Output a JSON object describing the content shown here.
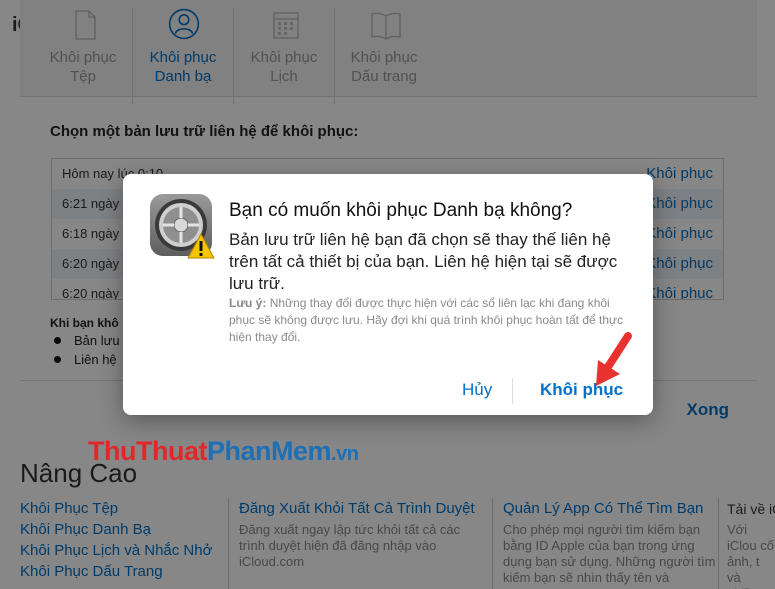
{
  "background": {
    "logo": "iC",
    "advanced_title": "Nâng Cao",
    "advanced_links": [
      "Khôi Phục Tệp",
      "Khôi Phục Danh Bạ",
      "Khôi Phục Lịch và Nhắc Nhở",
      "Khôi Phục Dấu Trang"
    ],
    "col2": {
      "title": "Đăng Xuất Khỏi Tất Cả Trình Duyệt",
      "desc": "Đăng xuất ngay lập tức khỏi tất cả các trình duyệt hiện đã đăng nhập vào iCloud.com"
    },
    "col3": {
      "title": "Quản Lý App Có Thể Tìm Bạn",
      "desc": "Cho phép mọi người tìm kiếm bạn bằng ID Apple của bạn trong ứng dụng bạn sử dụng. Những người tìm kiếm bạn sẽ nhìn thấy tên và"
    },
    "col4": {
      "title": "Tải về iC",
      "desc": "Với iClou cố ảnh, t và nhiều"
    }
  },
  "panel": {
    "tabs": [
      {
        "line1": "Khôi phục",
        "line2": "Tệp",
        "icon": "file-icon",
        "active": false
      },
      {
        "line1": "Khôi phục",
        "line2": "Danh bạ",
        "icon": "contact-icon",
        "active": true
      },
      {
        "line1": "Khôi phục",
        "line2": "Lịch",
        "icon": "calendar-icon",
        "active": false
      },
      {
        "line1": "Khôi phục",
        "line2": "Dấu trang",
        "icon": "book-icon",
        "active": false
      }
    ],
    "prompt": "Chọn một bản lưu trữ liên hệ để khôi phục:",
    "rows": [
      {
        "date": "Hôm nay lúc 0:10",
        "action": "Khôi phục"
      },
      {
        "date": "6:21 ngày",
        "action": "Khôi phục"
      },
      {
        "date": "6:18 ngày",
        "action": "Khôi phục"
      },
      {
        "date": "6:20 ngày",
        "action": "Khôi phục"
      },
      {
        "date": "6:20 ngày",
        "action": "Khôi phục"
      }
    ],
    "when_label": "Khi bạn khô",
    "bullets": [
      "Bản lưu",
      "Liên hệ"
    ],
    "done_label": "Xong"
  },
  "alert": {
    "icon": "settings-gear-icon",
    "warning_icon": "warning-icon",
    "title": "Bạn có muốn khôi phục Danh bạ không?",
    "message": "Bản lưu trữ liên hệ bạn đã chọn sẽ thay thế liên hệ trên tất cả thiết bị của bạn. Liên hệ hiện tại sẽ được lưu trữ.",
    "note_label": "Lưu ý:",
    "note_text": " Những thay đổi được thực hiện với các sổ liên lạc khi đang khôi phục sẽ không được lưu. Hãy đợi khi quá trình khôi phục hoàn tất để thực hiện thay đổi.",
    "cancel_label": "Hủy",
    "confirm_label": "Khôi phục"
  },
  "watermark": {
    "part1": "Thu",
    "part2": "Thuat",
    "part3": "PhanMem",
    "part4": ".vn"
  },
  "colors": {
    "accent": "#0070c9",
    "arrow": "#e8322f"
  }
}
